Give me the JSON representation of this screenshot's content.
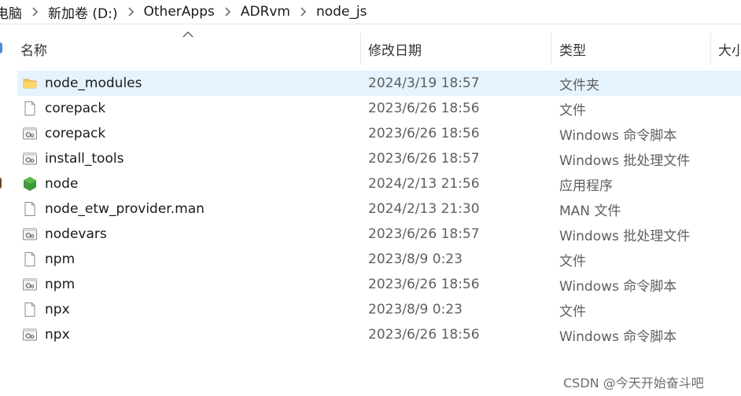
{
  "breadcrumb": {
    "items": [
      "电脑",
      "新加卷 (D:)",
      "OtherApps",
      "ADRvm",
      "node_js"
    ]
  },
  "columns": {
    "name": "名称",
    "date": "修改日期",
    "type": "类型",
    "size": "大小"
  },
  "files": [
    {
      "name": "node_modules",
      "date": "2024/3/19 18:57",
      "type": "文件夹",
      "icon": "folder-icon",
      "selected": true
    },
    {
      "name": "corepack",
      "date": "2023/6/26 18:56",
      "type": "文件",
      "icon": "blank-file-icon"
    },
    {
      "name": "corepack",
      "date": "2023/6/26 18:56",
      "type": "Windows 命令脚本",
      "icon": "script-file-icon"
    },
    {
      "name": "install_tools",
      "date": "2023/6/26 18:57",
      "type": "Windows 批处理文件",
      "icon": "script-file-icon"
    },
    {
      "name": "node",
      "date": "2024/2/13 21:56",
      "type": "应用程序",
      "icon": "nodejs-icon"
    },
    {
      "name": "node_etw_provider.man",
      "date": "2024/2/13 21:30",
      "type": "MAN 文件",
      "icon": "blank-file-icon"
    },
    {
      "name": "nodevars",
      "date": "2023/6/26 18:57",
      "type": "Windows 批处理文件",
      "icon": "script-file-icon"
    },
    {
      "name": "npm",
      "date": "2023/8/9 0:23",
      "type": "文件",
      "icon": "blank-file-icon"
    },
    {
      "name": "npm",
      "date": "2023/6/26 18:56",
      "type": "Windows 命令脚本",
      "icon": "script-file-icon"
    },
    {
      "name": "npx",
      "date": "2023/8/9 0:23",
      "type": "文件",
      "icon": "blank-file-icon"
    },
    {
      "name": "npx",
      "date": "2023/6/26 18:56",
      "type": "Windows 命令脚本",
      "icon": "script-file-icon"
    }
  ],
  "watermark": "CSDN @今天开始奋斗吧",
  "colors": {
    "selection": "#e5f3ff",
    "folder": "#f3c24b",
    "nodejs": "#3f9a3a"
  }
}
